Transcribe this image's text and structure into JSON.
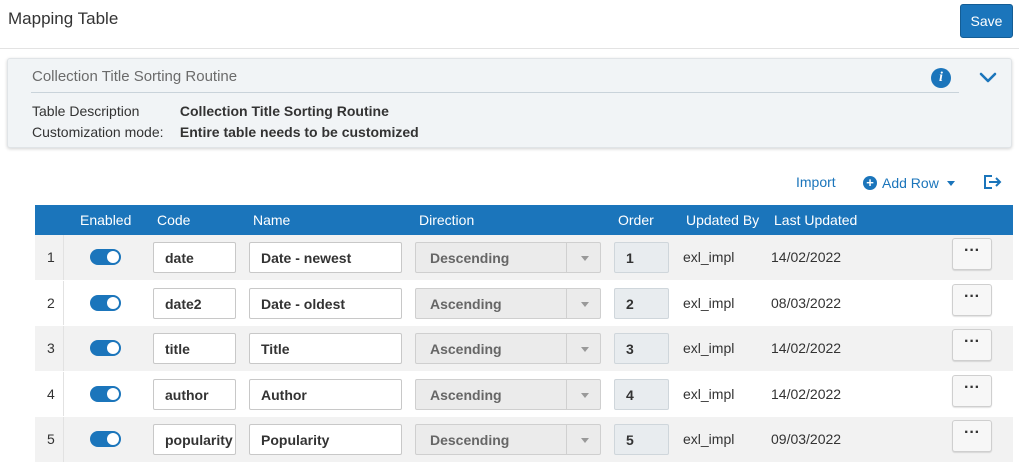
{
  "header": {
    "title": "Mapping Table",
    "save_label": "Save"
  },
  "info": {
    "title": "Collection Title Sorting Routine",
    "description_label": "Table Description",
    "description_value": "Collection Title Sorting Routine",
    "mode_label": "Customization mode:",
    "mode_value": "Entire table needs to be customized"
  },
  "actions": {
    "import_label": "Import",
    "add_row_label": "Add Row"
  },
  "table": {
    "columns": [
      "Enabled",
      "Code",
      "Name",
      "Direction",
      "Order",
      "Updated By",
      "Last Updated"
    ],
    "rows": [
      {
        "num": "1",
        "enabled": true,
        "code": "date",
        "name": "Date - newest",
        "direction": "Descending",
        "order": "1",
        "updated_by": "exl_impl",
        "last_updated": "14/02/2022",
        "more": "···"
      },
      {
        "num": "2",
        "enabled": true,
        "code": "date2",
        "name": "Date - oldest",
        "direction": "Ascending",
        "order": "2",
        "updated_by": "exl_impl",
        "last_updated": "08/03/2022",
        "more": "···"
      },
      {
        "num": "3",
        "enabled": true,
        "code": "title",
        "name": "Title",
        "direction": "Ascending",
        "order": "3",
        "updated_by": "exl_impl",
        "last_updated": "14/02/2022",
        "more": "···"
      },
      {
        "num": "4",
        "enabled": true,
        "code": "author",
        "name": "Author",
        "direction": "Ascending",
        "order": "4",
        "updated_by": "exl_impl",
        "last_updated": "14/02/2022",
        "more": "···"
      },
      {
        "num": "5",
        "enabled": true,
        "code": "popularity",
        "name": "Popularity",
        "direction": "Descending",
        "order": "5",
        "updated_by": "exl_impl",
        "last_updated": "09/03/2022",
        "more": "···"
      }
    ]
  },
  "colors": {
    "accent": "#1b75bb",
    "header_bg": "#1b75bb",
    "card_bg": "#f1f4f6"
  },
  "icons": {
    "info": "info-icon",
    "collapse": "chevron-down-icon",
    "add": "plus-circle-icon",
    "export": "export-icon",
    "more": "ellipsis-icon",
    "toggle": "toggle-switch"
  }
}
